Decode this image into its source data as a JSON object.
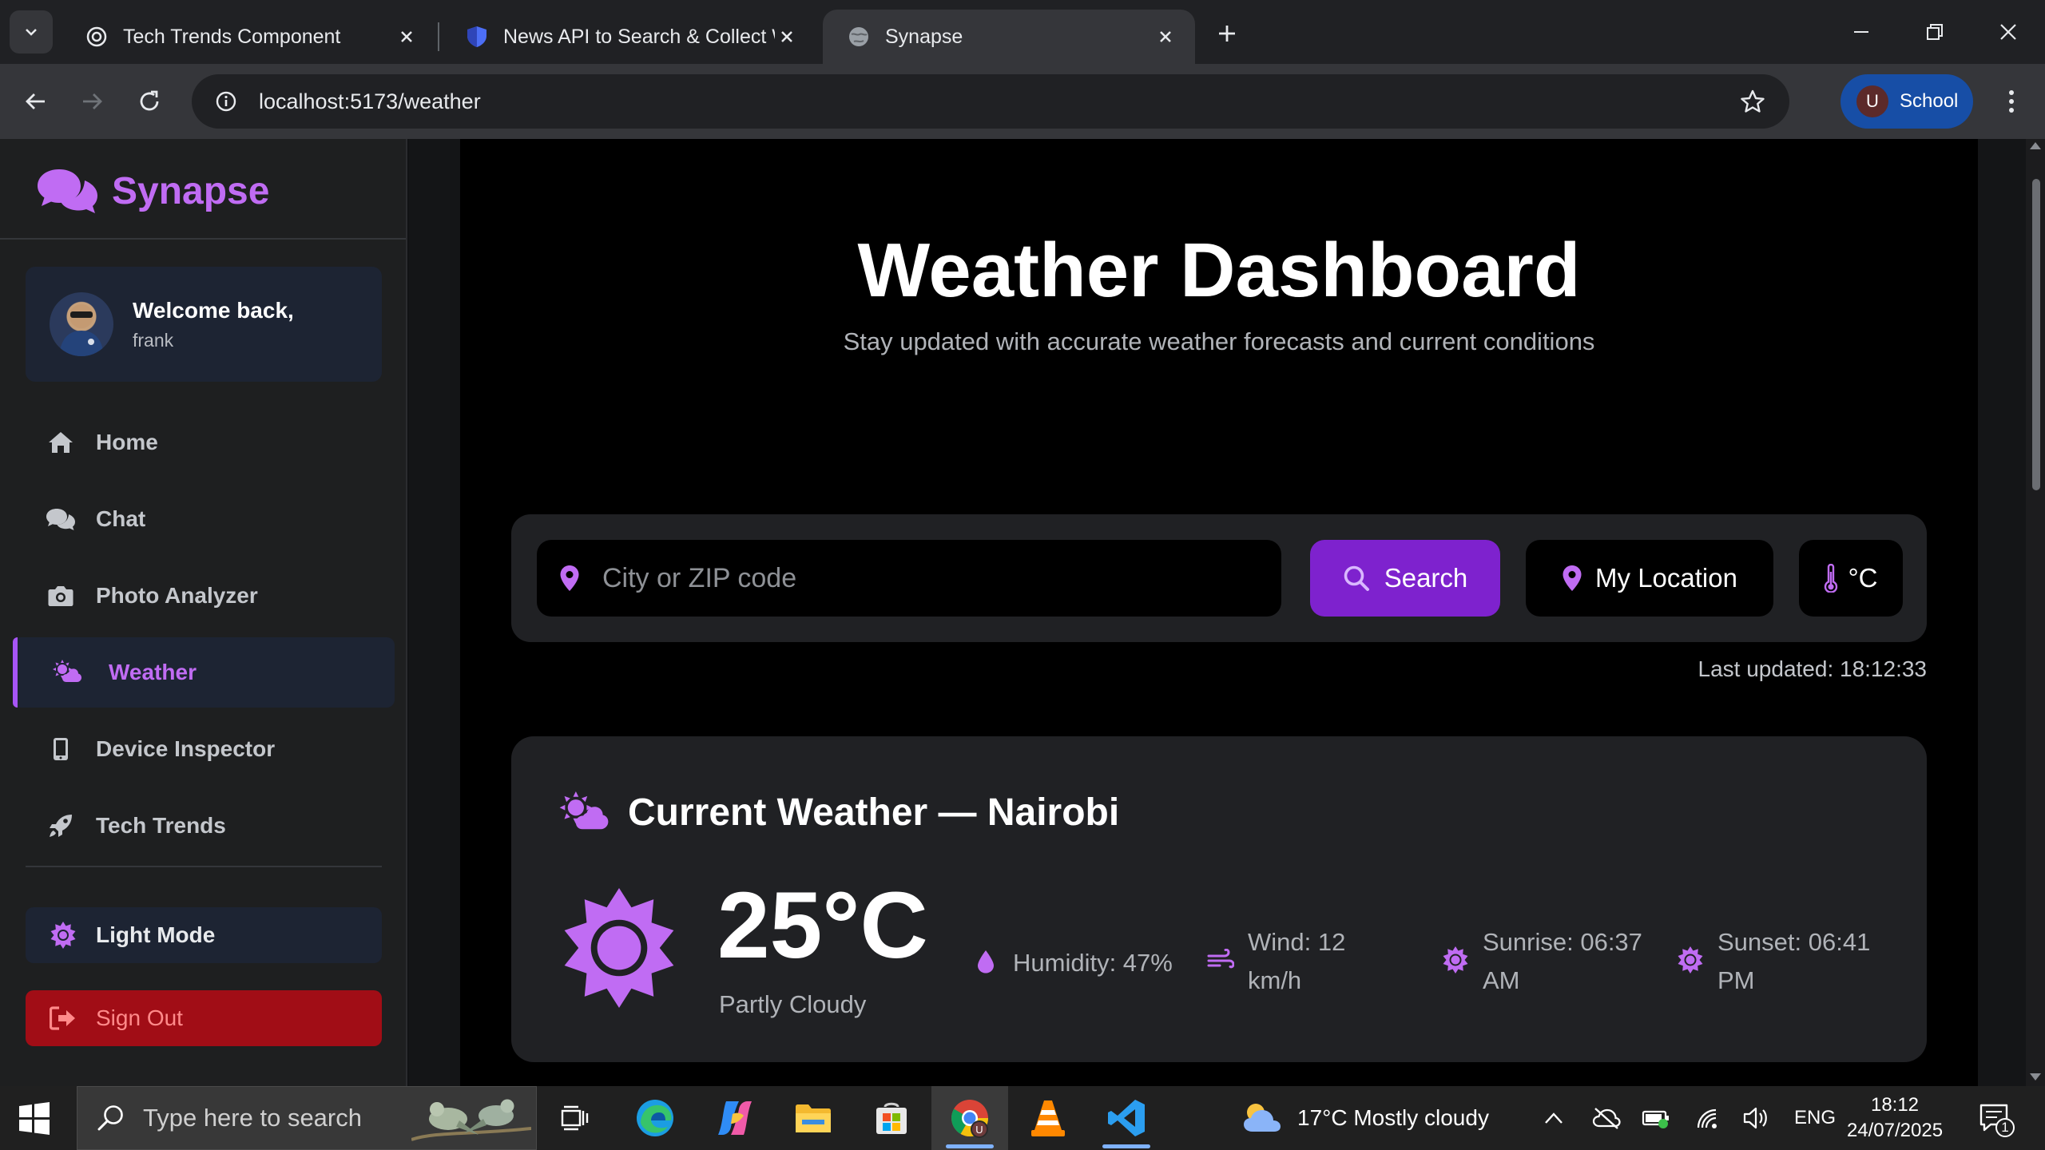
{
  "browser": {
    "tabs": [
      {
        "title": "Tech Trends Component",
        "icon": "openai-icon"
      },
      {
        "title": "News API to Search & Collect W",
        "icon": "shield-icon"
      },
      {
        "title": "Synapse",
        "icon": "globe-icon"
      }
    ],
    "url": "localhost:5173/weather",
    "profile_initial": "U",
    "profile_label": "School"
  },
  "sidebar": {
    "brand": "Synapse",
    "welcome_title": "Welcome back,",
    "username": "frank",
    "nav": [
      {
        "label": "Home",
        "icon": "home-icon"
      },
      {
        "label": "Chat",
        "icon": "chat-icon"
      },
      {
        "label": "Photo Analyzer",
        "icon": "camera-icon"
      },
      {
        "label": "Weather",
        "icon": "weather-icon",
        "active": true
      },
      {
        "label": "Device Inspector",
        "icon": "mobile-icon"
      },
      {
        "label": "Tech Trends",
        "icon": "rocket-icon"
      }
    ],
    "mode_label": "Light Mode",
    "signout_label": "Sign Out"
  },
  "main": {
    "title": "Weather Dashboard",
    "subtitle": "Stay updated with accurate weather forecasts and current conditions",
    "search": {
      "placeholder": "City or ZIP code",
      "value": "",
      "button_label": "Search",
      "location_label": "My Location",
      "unit_label": "°C"
    },
    "last_updated": "Last updated: 18:12:33",
    "current": {
      "heading": "Current Weather — Nairobi",
      "temperature": "25°C",
      "condition": "Partly Cloudy",
      "humidity": "Humidity: 47%",
      "wind_line1": "Wind: 12",
      "wind_line2": "km/h",
      "sunrise_line1": "Sunrise: 06:37",
      "sunrise_line2": "AM",
      "sunset_line1": "Sunset: 06:41",
      "sunset_line2": "PM"
    }
  },
  "taskbar": {
    "search_placeholder": "Type here to search",
    "weather_text": "17°C  Mostly cloudy",
    "language": "ENG",
    "time": "18:12",
    "date": "24/07/2025",
    "notification_count": "1"
  },
  "colors": {
    "accent": "#a855f7",
    "accent_button": "#7e22ce",
    "danger": "#a10d16",
    "card": "#202124"
  }
}
